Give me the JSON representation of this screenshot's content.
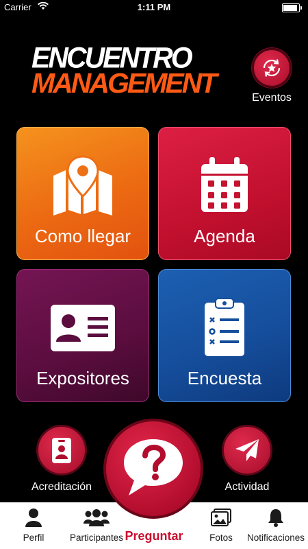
{
  "status_bar": {
    "carrier": "Carrier",
    "time": "1:11 PM"
  },
  "logo": {
    "line1": "ENCUENTRO",
    "line2": "MANAGEMENT",
    "colors": {
      "line1": "#ffffff",
      "line2": "#ff5a14"
    }
  },
  "eventos": {
    "label": "Eventos",
    "icon": "star-refresh-icon"
  },
  "tiles": [
    {
      "label": "Como llegar",
      "icon": "map-pin-icon",
      "color": "#ec6a12"
    },
    {
      "label": "Agenda",
      "icon": "calendar-icon",
      "color": "#c2102f"
    },
    {
      "label": "Expositores",
      "icon": "id-card-icon",
      "color": "#5a0d3e"
    },
    {
      "label": "Encuesta",
      "icon": "clipboard-checklist-icon",
      "color": "#154e9c"
    }
  ],
  "actions": {
    "acreditacion": {
      "label": "Acreditación",
      "icon": "badge-icon"
    },
    "actividad": {
      "label": "Actividad",
      "icon": "paper-plane-icon"
    },
    "preguntar": {
      "label": "Preguntar",
      "icon": "question-bubble-icon"
    }
  },
  "tabbar": [
    {
      "label": "Perfil",
      "icon": "user-icon"
    },
    {
      "label": "Participantes",
      "icon": "users-icon"
    },
    {
      "label": "Fotos",
      "icon": "photos-icon"
    },
    {
      "label": "Notificaciones",
      "icon": "bell-icon"
    }
  ],
  "accent_color": "#c8102e"
}
